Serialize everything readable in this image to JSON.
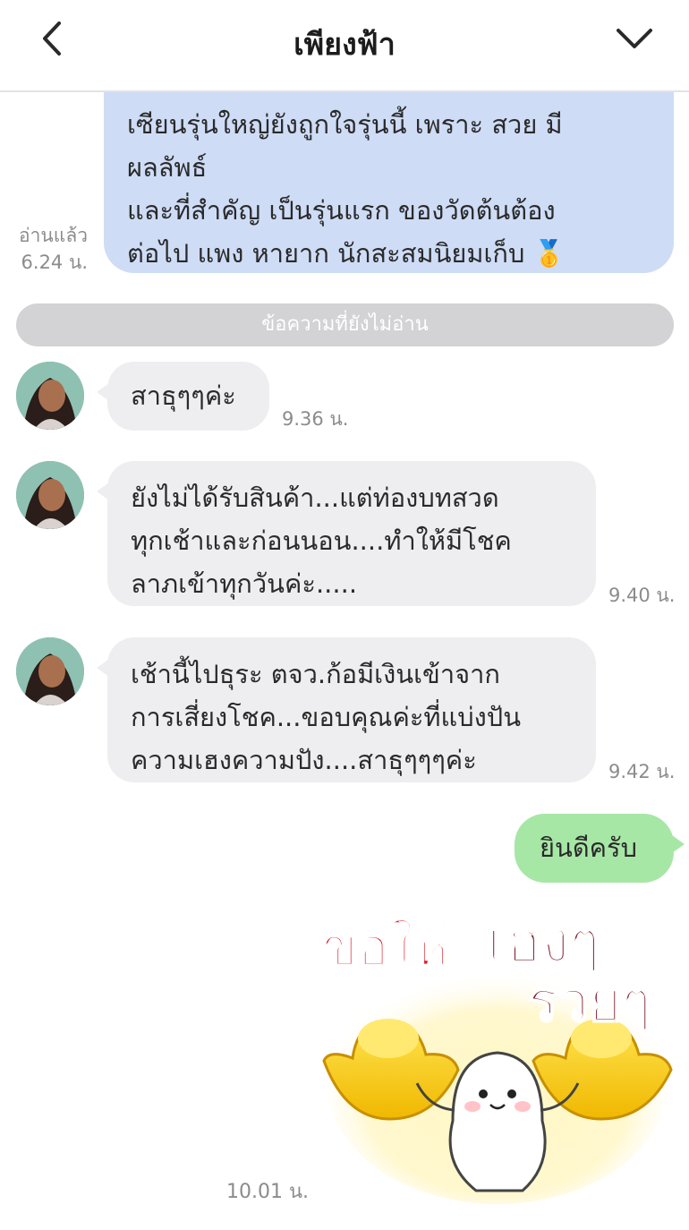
{
  "header": {
    "title": "เพียงฟ้า",
    "back_icon": "chevron-left-icon",
    "menu_icon": "chevron-down-icon"
  },
  "messages": {
    "outgoing_1": {
      "text": "เซียนรุ่นใหญ่ยังถูกใจรุ่นนี้ เพราะ สวย มี\nผลลัพธ์\nและที่สำคัญ เป็นรุ่นแรก ของวัดต้นต้อง\nต่อไป แพง หายาก นักสะสมนิยมเก็บ 🥇",
      "read_status": "อ่านแล้ว",
      "time": "6.24 น."
    },
    "unread_divider": "ข้อความที่ยังไม่อ่าน",
    "incoming_1": {
      "text": "สาธุๆๆค่ะ",
      "time": "9.36 น."
    },
    "incoming_2": {
      "text": "ยังไม่ได้รับสินค้า...แต่ท่องบทสวด\nทุกเช้าและก่อนนอน....ทำให้มีโชค\nลาภเข้าทุกวันค่ะ.....",
      "time": "9.40 น."
    },
    "incoming_3": {
      "text": "เช้านี้ไปธุระ ตจว.ก้อมีเงินเข้าจาก\nการเสี่ยงโชค...ขอบคุณค่ะที่แบ่งปัน\nความเฮงความปัง....สาธุๆๆๆค่ะ",
      "time": "9.42 น."
    },
    "outgoing_2": {
      "text": "ยินดีครับ"
    },
    "sticker": {
      "line_1a": "ขอให้",
      "line_1b": "เฮงๆ",
      "line_2": "รวยๆ",
      "time": "10.01 น."
    }
  },
  "colors": {
    "outgoing_blue": "#cfdcf6",
    "outgoing_green": "#a7e7a6",
    "incoming_gray": "#eeeef0",
    "divider_gray": "#d3d3d5",
    "sticker_red": "#e01f2a",
    "sticker_maroon": "#7a1422",
    "gold": "#f5c800"
  }
}
